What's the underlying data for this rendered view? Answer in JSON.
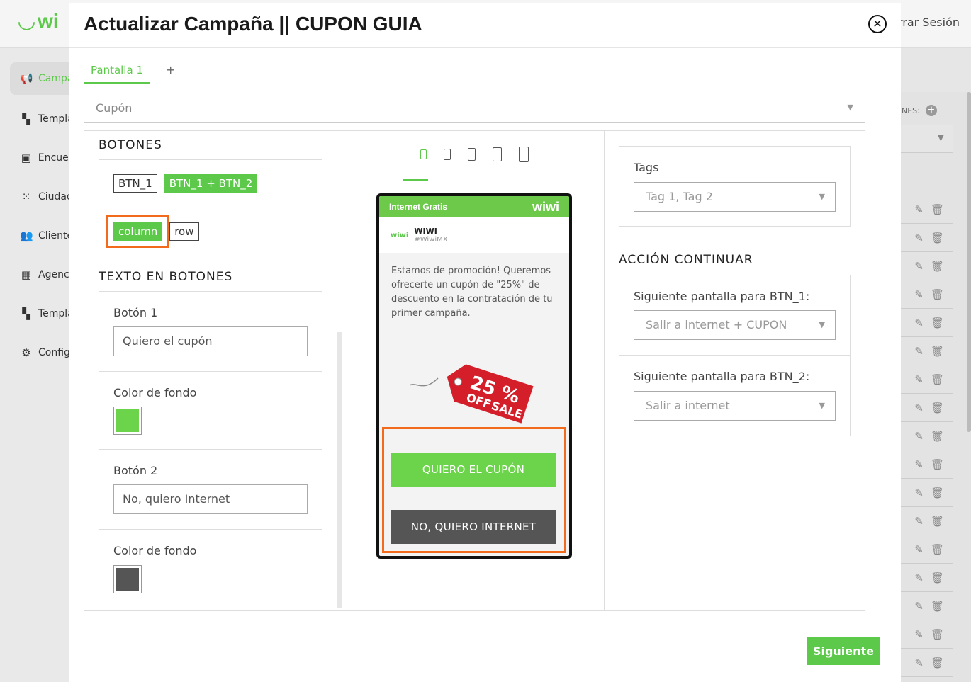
{
  "background": {
    "logo_text": "wi",
    "logout_label": "rrar Sesión",
    "nav": [
      {
        "icon": "megaphone-icon",
        "glyph": "📢",
        "label": "Campa"
      },
      {
        "icon": "template-icon",
        "glyph": "▚",
        "label": "Templa"
      },
      {
        "icon": "clipboard-icon",
        "glyph": "▣",
        "label": "Encues"
      },
      {
        "icon": "grid-dots-icon",
        "glyph": "⁙",
        "label": "Ciudad"
      },
      {
        "icon": "users-icon",
        "glyph": "👥",
        "label": "Cliente"
      },
      {
        "icon": "building-icon",
        "glyph": "▦",
        "label": "Agenc"
      },
      {
        "icon": "template-icon",
        "glyph": "▚",
        "label": "Templa"
      },
      {
        "icon": "gear-icon",
        "glyph": "⚙",
        "label": "Config"
      }
    ],
    "right_header": "NES:",
    "right_select_arrow": "▼"
  },
  "modal": {
    "title": "Actualizar Campaña || CUPON GUIA",
    "close_glyph": "✕",
    "tabs": [
      {
        "label": "Pantalla 1"
      }
    ],
    "add_tab_label": "+",
    "screen_type": "Cupón",
    "select_arrow": "▼",
    "left": {
      "buttons_title": "BOTONES",
      "btn_options": [
        "BTN_1",
        "BTN_1 + BTN_2"
      ],
      "layout_options": [
        "column",
        "row"
      ],
      "text_title": "TEXTO EN BOTONES",
      "btn1_label": "Botón 1",
      "btn1_value": "Quiero el cupón",
      "bg_color_label": "Color de fondo",
      "btn1_color": "#6cd44a",
      "btn2_label": "Botón 2",
      "btn2_value": "No, quiero Internet",
      "btn2_color": "#555555"
    },
    "preview": {
      "top_bar_text": "Internet Gratis",
      "top_bar_logo": "wiwi",
      "brand_logo": "wiwi",
      "brand_name": "WIWI",
      "brand_handle": "#WiwiMX",
      "message": "Estamos de promoción! Queremos ofrecerte un cupón de \"25%\" de descuento en la contratación de tu primer campaña.",
      "tag_percent": "25 %",
      "tag_line1": "OFF",
      "tag_line2": "SALE",
      "btn1": "QUIERO EL CUPÓN",
      "btn2": "NO, QUIERO INTERNET"
    },
    "right": {
      "tags_label": "Tags",
      "tags_placeholder": "Tag 1, Tag 2",
      "action_title": "ACCIÓN CONTINUAR",
      "btn1_next_label": "Siguiente pantalla para BTN_1:",
      "btn1_next_value": "Salir a internet + CUPON",
      "btn2_next_label": "Siguiente pantalla para BTN_2:",
      "btn2_next_value": "Salir a internet"
    },
    "next_button": "Siguiente"
  }
}
